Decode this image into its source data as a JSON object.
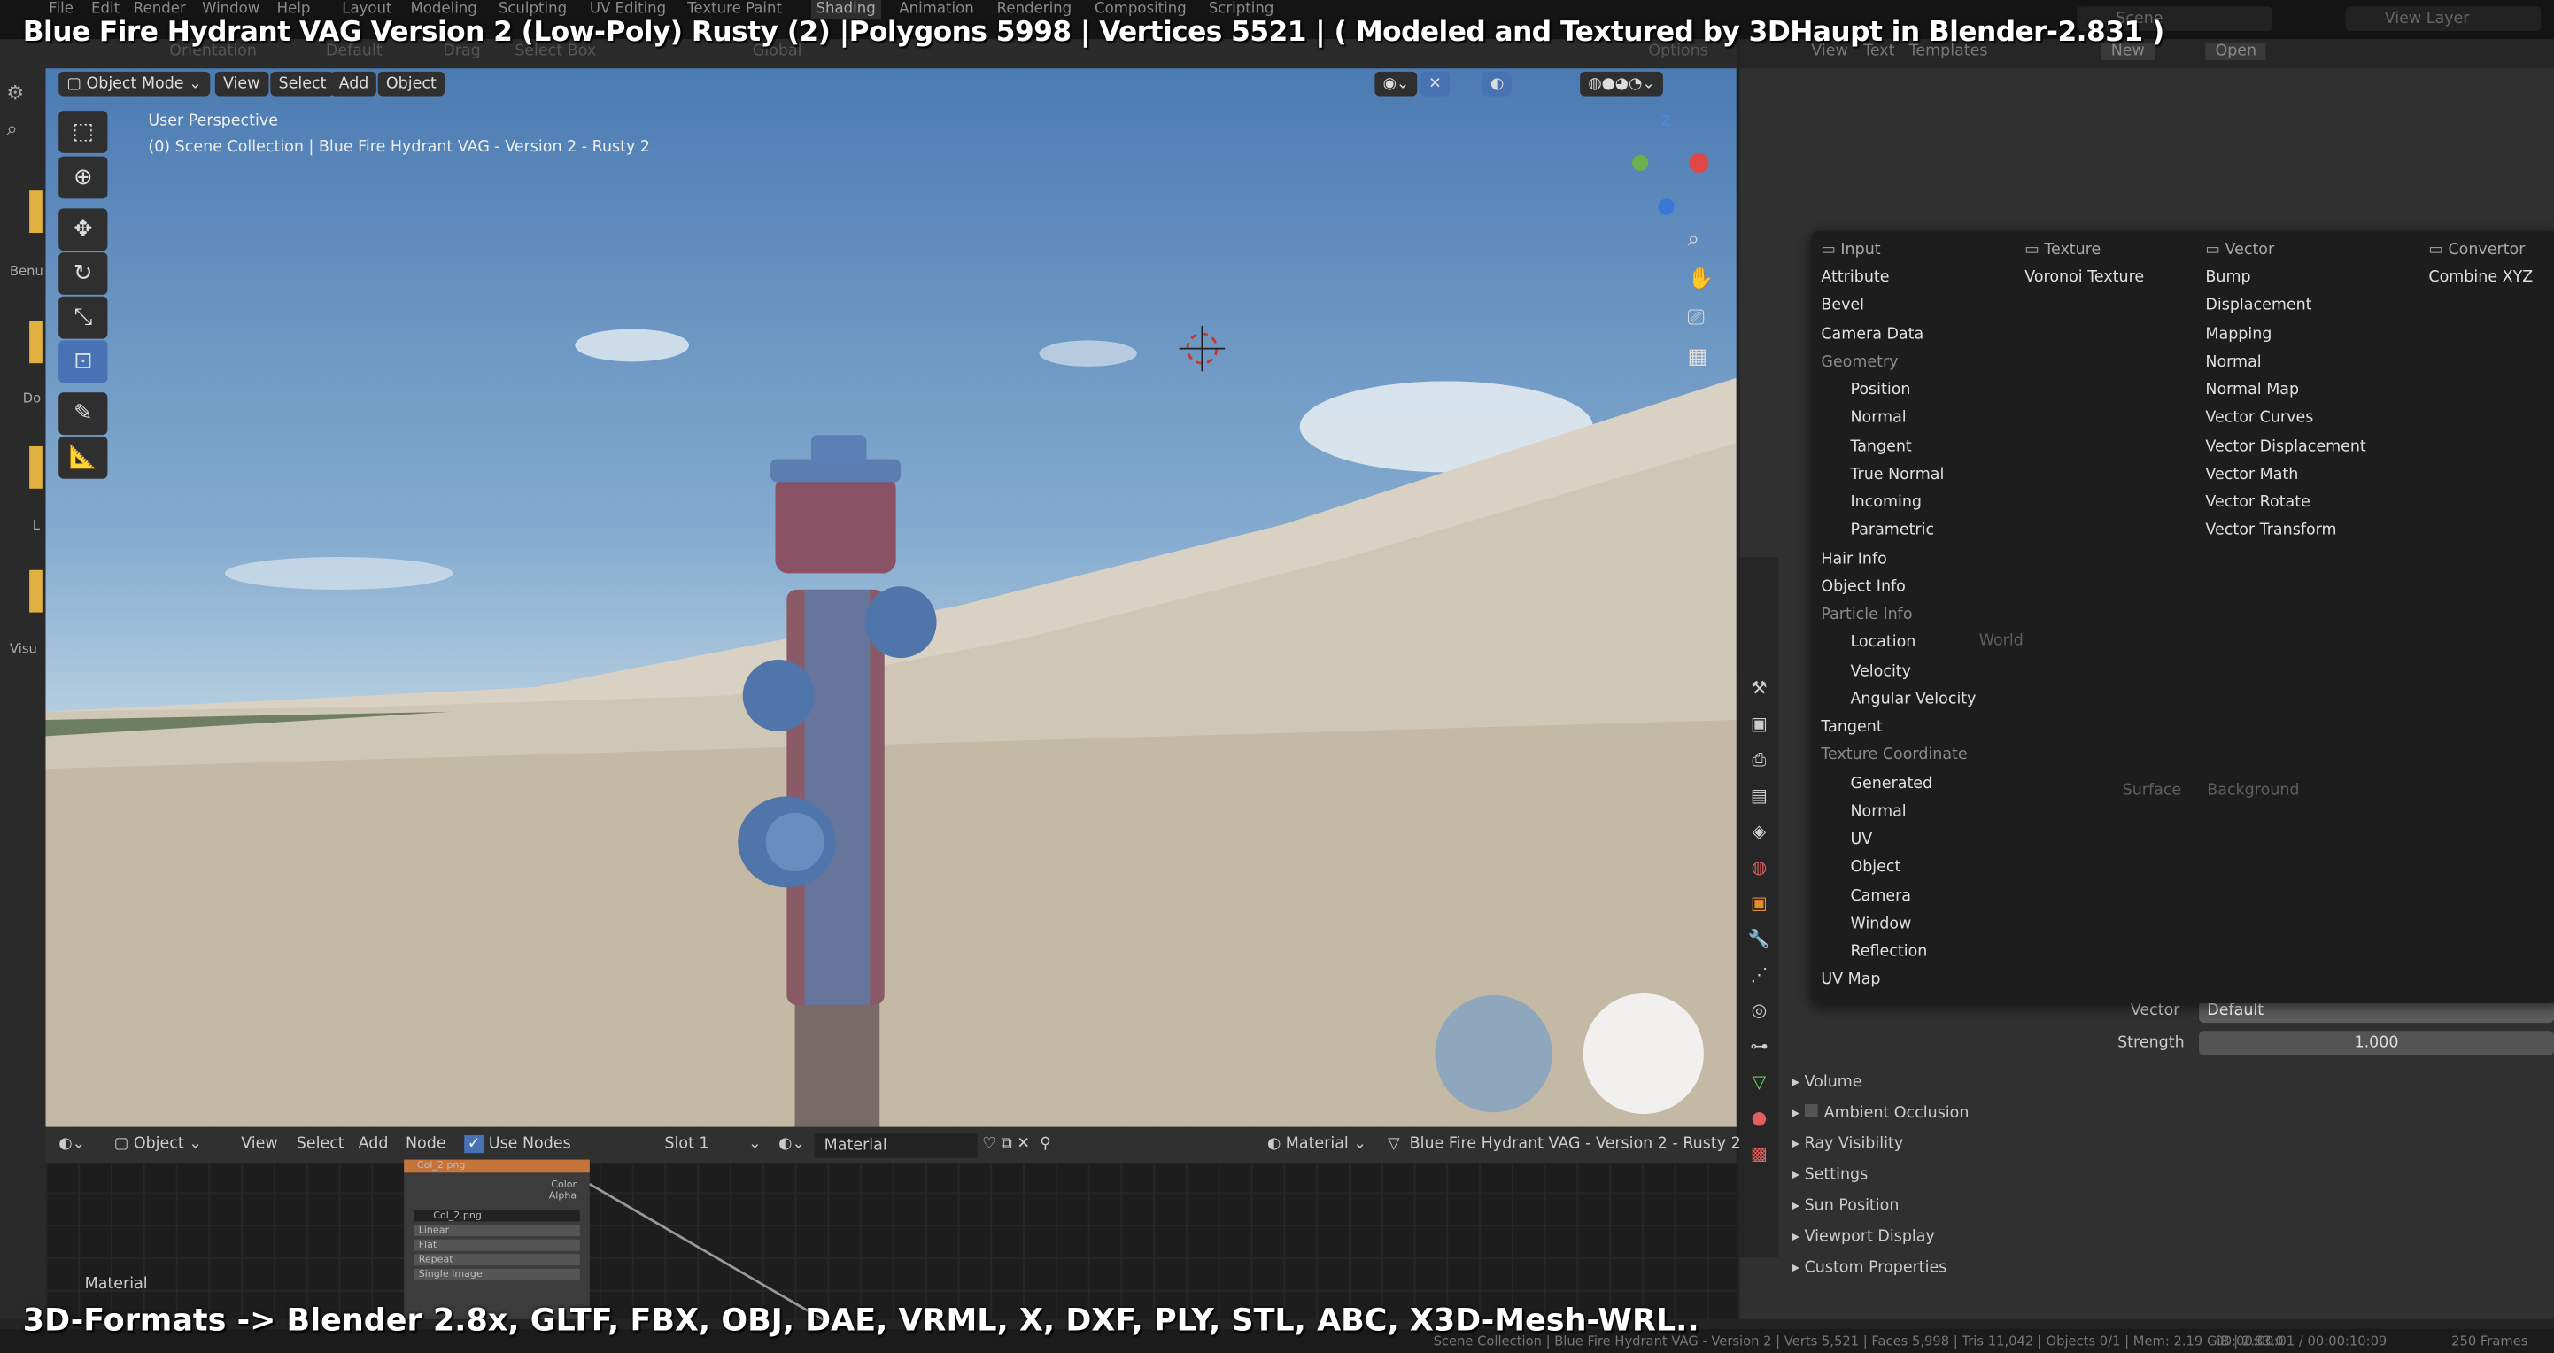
{
  "overlay": {
    "title": "Blue Fire Hydrant VAG Version 2 (Low-Poly) Rusty (2) |Polygons 5998 | Vertices 5521 | ( Modeled and Textured by 3DHaupt in Blender-2.831 )",
    "bottom": "3D-Formats -> Blender 2.8x, GLTF, FBX, OBJ, DAE, VRML, X, DXF, PLY, STL, ABC, X3D-Mesh-WRL.."
  },
  "topbar": {
    "menus": [
      "File",
      "Edit",
      "Render",
      "Window",
      "Help"
    ],
    "workspaces": [
      "Layout",
      "Modeling",
      "Sculpting",
      "UV Editing",
      "Texture Paint",
      "Shading",
      "Animation",
      "Rendering",
      "Compositing",
      "Scripting"
    ],
    "scene": "Scene",
    "view_layer": "View Layer"
  },
  "tool_header": {
    "orientation": "Orientation",
    "default": "Default",
    "drag": "Drag",
    "select_box": "Select Box",
    "global": "Global",
    "options": "Options"
  },
  "text_header": {
    "view": "View",
    "text": "Text",
    "templates": "Templates",
    "new": "New",
    "open": "Open"
  },
  "viewport": {
    "mode": "Object Mode",
    "menus": [
      "View",
      "Select",
      "Add",
      "Object"
    ],
    "perspective": "User Perspective",
    "collection": "(0) Scene Collection | Blue Fire Hydrant VAG - Version 2 - Rusty 2",
    "gizmo_z": "Z"
  },
  "left_labels": [
    "Benu",
    "Do",
    "L",
    "Visu"
  ],
  "add_menu": {
    "columns": [
      {
        "header": "Input",
        "items": [
          {
            "label": "Attribute"
          },
          {
            "label": "Bevel"
          },
          {
            "label": "Camera Data"
          },
          {
            "label": "Geometry",
            "dim": true
          },
          {
            "label": "Position",
            "indent": true
          },
          {
            "label": "Normal",
            "indent": true
          },
          {
            "label": "Tangent",
            "indent": true
          },
          {
            "label": "True Normal",
            "indent": true
          },
          {
            "label": "Incoming",
            "indent": true
          },
          {
            "label": "Parametric",
            "indent": true
          },
          {
            "label": "Hair Info"
          },
          {
            "label": "Object Info"
          },
          {
            "label": "Particle Info",
            "dim": true
          },
          {
            "label": "Location",
            "indent": true
          },
          {
            "label": "Velocity",
            "indent": true
          },
          {
            "label": "Angular Velocity",
            "indent": true
          },
          {
            "label": "Tangent"
          },
          {
            "label": "Texture Coordinate",
            "dim": true
          },
          {
            "label": "Generated",
            "indent": true
          },
          {
            "label": "Normal",
            "indent": true
          },
          {
            "label": "UV",
            "indent": true
          },
          {
            "label": "Object",
            "indent": true
          },
          {
            "label": "Camera",
            "indent": true
          },
          {
            "label": "Window",
            "indent": true
          },
          {
            "label": "Reflection",
            "indent": true
          },
          {
            "label": "UV Map"
          }
        ]
      },
      {
        "header": "Texture",
        "items": [
          {
            "label": "Voronoi Texture"
          }
        ]
      },
      {
        "header": "Vector",
        "items": [
          {
            "label": "Bump"
          },
          {
            "label": "Displacement"
          },
          {
            "label": "Mapping"
          },
          {
            "label": "Normal"
          },
          {
            "label": "Normal Map"
          },
          {
            "label": "Vector Curves"
          },
          {
            "label": "Vector Displacement"
          },
          {
            "label": "Vector Math"
          },
          {
            "label": "Vector Rotate"
          },
          {
            "label": "Vector Transform"
          }
        ]
      },
      {
        "header": "Convertor",
        "items": [
          {
            "label": "Combine XYZ"
          }
        ]
      }
    ]
  },
  "properties": {
    "vector_label": "Vector",
    "vector_value": "Default",
    "strength_label": "Strength",
    "strength_value": "1.000",
    "panels": [
      "Volume",
      "Ambient Occlusion",
      "Ray Visibility",
      "Settings",
      "Sun Position",
      "Viewport Display",
      "Custom Properties"
    ],
    "faded": {
      "surface_label": "Surface",
      "surface_value": "Background",
      "world": "World"
    }
  },
  "node_editor": {
    "object": "Object",
    "menus": [
      "View",
      "Select",
      "Add",
      "Node"
    ],
    "use_nodes": "Use Nodes",
    "use_nodes_checked": true,
    "slot": "Slot 1",
    "material": "Material",
    "material_type": "Material",
    "object_name": "Blue Fire Hydrant VAG - Version 2 - Rusty 2",
    "corner_label": "Material",
    "node": {
      "title": "Col_2.png",
      "out_color": "Color",
      "out_alpha": "Alpha",
      "image": "Col_2.png",
      "options": [
        "Linear",
        "Flat",
        "Repeat",
        "Single Image"
      ]
    }
  },
  "status": {
    "text": "Scene Collection | Blue Fire Hydrant VAG - Version 2 | Verts 5,521 | Faces 5,998 | Tris 11,042 | Objects 0/1 | Mem: 2.19 GiB | 2.83.0",
    "time": "00:00:00:01 / 00:00:10:09",
    "frames": "250 Frames"
  }
}
